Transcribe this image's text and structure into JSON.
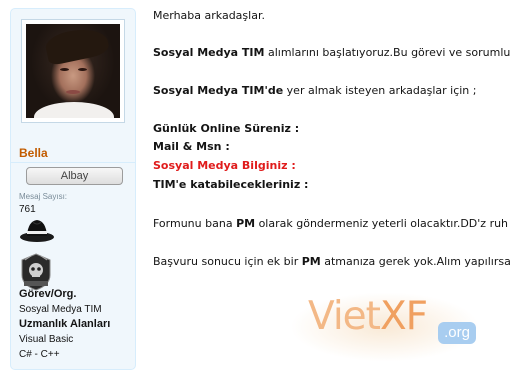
{
  "user": {
    "name": "Bella",
    "rank": "Albay",
    "message_count_label": "Mesaj Sayısı:",
    "message_count": "761",
    "fields": [
      {
        "title": "Görev/Org.",
        "value": "Sosyal Medya TIM"
      },
      {
        "title": "Uzmanlık Alanları",
        "value": "Visual Basic"
      },
      {
        "title": "",
        "value": "C# - C++"
      }
    ]
  },
  "post": {
    "greeting": "Merhaba arkadaşlar.",
    "announce_bold": "Sosyal Medya TIM",
    "announce_rest": " alımlarını başlatıyoruz.Bu görevi ve sorumlu",
    "invite_bold": "Sosyal Medya TIM'de",
    "invite_rest": " yer almak isteyen arkadaşlar için ;",
    "form_fields": [
      "Günlük Online Süreniz :",
      "Mail & Msn :",
      "Sosyal Medya Bilginiz :",
      "TIM'e katabilecekleriniz :"
    ],
    "form_instr_1": "Formunu bana ",
    "form_instr_pm": "PM",
    "form_instr_2": " olarak göndermeniz yeterli olacaktır.DD'z ruh",
    "apply_1": "Başvuru sonucu için ek bir ",
    "apply_pm": "PM",
    "apply_2": " atmanıza gerek yok.Alım yapılırsa"
  },
  "watermark": {
    "brand_a": "Viet",
    "brand_b": "XF",
    "tld": ".org"
  },
  "colors": {
    "username": "#c25c00",
    "highlight": "#e01b1b",
    "sidebar_bg": "#f0f7fc"
  },
  "icons": [
    "fedora-hat-icon",
    "skull-emblem-icon"
  ]
}
